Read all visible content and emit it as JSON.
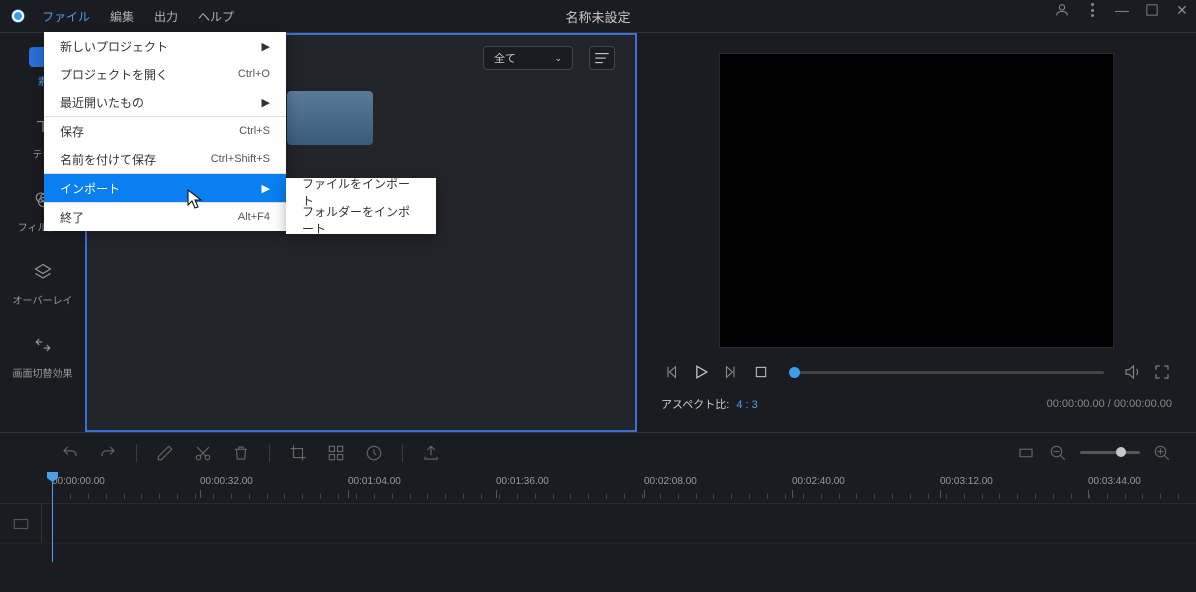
{
  "title": "名称未設定",
  "menubar": {
    "file": "ファイル",
    "edit": "編集",
    "output": "出力",
    "help": "ヘルプ"
  },
  "file_menu": {
    "new_project": "新しいプロジェクト",
    "open_project": "プロジェクトを開く",
    "open_shortcut": "Ctrl+O",
    "recent": "最近開いたもの",
    "save": "保存",
    "save_shortcut": "Ctrl+S",
    "save_as": "名前を付けて保存",
    "save_as_shortcut": "Ctrl+Shift+S",
    "import": "インポート",
    "exit": "終了",
    "exit_shortcut": "Alt+F4"
  },
  "import_sub": {
    "file": "ファイルをインポート",
    "folder": "フォルダーをインポート"
  },
  "sidebar": {
    "media": "素",
    "text": "テキ",
    "filter": "フィルター",
    "overlay": "オーバーレイ",
    "transition": "画面切替効果"
  },
  "media_panel": {
    "filter_all": "全て"
  },
  "preview": {
    "aspect_label": "アスペクト比:",
    "aspect_value": "4 : 3",
    "timecode": "00:00:00.00 / 00:00:00.00"
  },
  "timeline": {
    "marks": [
      "00:00:00.00",
      "00:00:32.00",
      "00:01:04.00",
      "00:01:36.00",
      "00:02:08.00",
      "00:02:40.00",
      "00:03:12.00",
      "00:03:44.00"
    ]
  }
}
